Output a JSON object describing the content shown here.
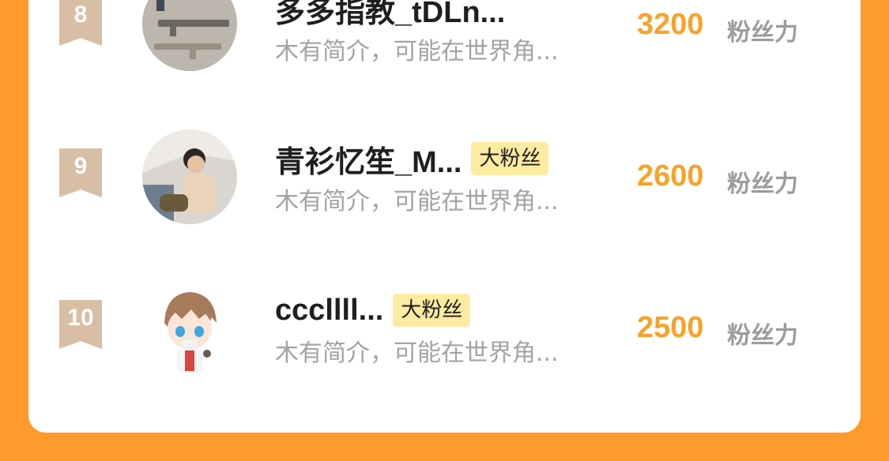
{
  "colors": {
    "background": "#FF9A2E",
    "card": "#FFFFFF",
    "score": "#F7A32A",
    "rank_badge": "#D8BEA5",
    "tag_bg": "#FDEBA1",
    "intro": "#A3A3A3"
  },
  "rows": [
    {
      "rank": "8",
      "name": "多多指教_tDLn...",
      "tag": "",
      "intro": "木有简介，可能在世界角...",
      "score": "3200",
      "unit": "粉丝力",
      "avatar": "toy-guns-photo"
    },
    {
      "rank": "9",
      "name": "青衫忆笙_M...",
      "tag": "大粉丝",
      "intro": "木有简介，可能在世界角...",
      "score": "2600",
      "unit": "粉丝力",
      "avatar": "boy-photo"
    },
    {
      "rank": "10",
      "name": "cccllll...",
      "tag": "大粉丝",
      "intro": "木有简介，可能在世界角...",
      "score": "2500",
      "unit": "粉丝力",
      "avatar": "anime-boy"
    }
  ]
}
